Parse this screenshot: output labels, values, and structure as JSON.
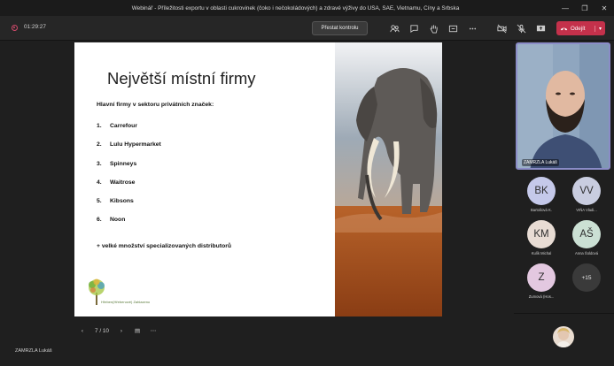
{
  "window": {
    "title": "Webinář - Příležitosti exportu v oblasti cukrovinek (čoko i nečokoládových) a zdravé výživy do USA, SAE, Vietnamu, Číny a Srbska"
  },
  "toolbar": {
    "timer": "01:29:27",
    "stop_presenting": "Přestat kontrolu",
    "leave": "Odejít"
  },
  "slide": {
    "title": "Největší místní firmy",
    "subtitle": "Hlavní firmy v sektoru privátních značek:",
    "items": [
      {
        "num": "1.",
        "name": "Carrefour"
      },
      {
        "num": "2.",
        "name": "Lulu Hypermarket"
      },
      {
        "num": "3.",
        "name": "Spinneys"
      },
      {
        "num": "4.",
        "name": "Waitrose"
      },
      {
        "num": "5.",
        "name": "Kibsons"
      },
      {
        "num": "6.",
        "name": "Noon"
      }
    ],
    "note": "+ velké množství specializovaných distributorů",
    "logo_text": "Hřeben(Hřebenové) Zahlazeno"
  },
  "slide_nav": {
    "page": "7 / 10"
  },
  "presenter": {
    "name": "ZAMRZLA Lukáš"
  },
  "main_video": {
    "label": "ZAMRZLA Lukáš"
  },
  "participants": [
    {
      "initials": "BK",
      "name": "Bartošová K.",
      "color": "#c5c9ea"
    },
    {
      "initials": "VV",
      "name": "VIŇA Vladi...",
      "color": "#c9cde0"
    },
    {
      "initials": "KM",
      "name": "Kulík Michal",
      "color": "#e8dcd4"
    },
    {
      "initials": "AŠ",
      "name": "Anna Šoldová",
      "color": "#cbe0d4"
    },
    {
      "initials": "Z",
      "name": "Zumová (Hos...",
      "color": "#e3c8e0"
    }
  ],
  "more_participants": "+15",
  "colors": {
    "accent": "#8b8cc7",
    "leave": "#c4314b"
  }
}
